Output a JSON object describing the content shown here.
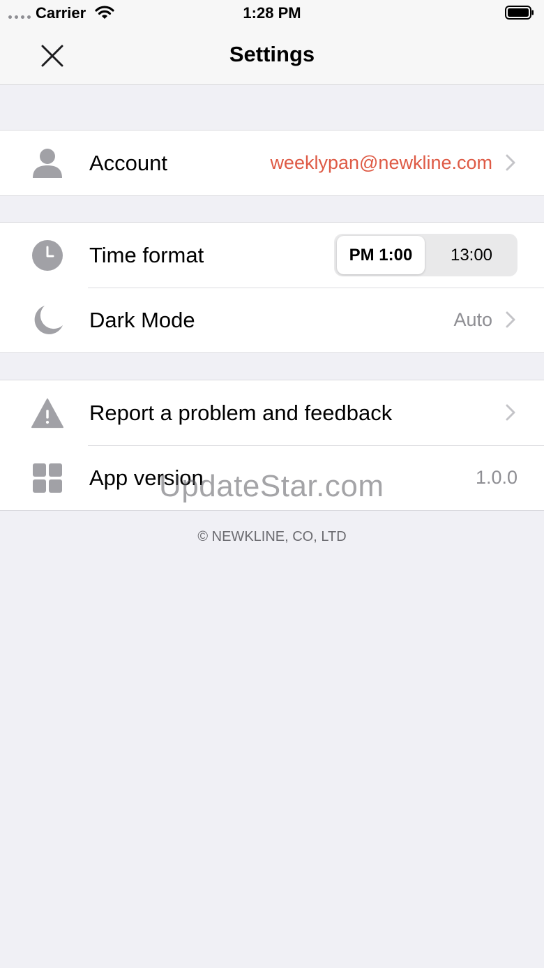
{
  "status_bar": {
    "carrier": "Carrier",
    "time": "1:28 PM"
  },
  "nav": {
    "title": "Settings"
  },
  "account": {
    "label": "Account",
    "value": "weeklypan@newkline.com"
  },
  "time_format": {
    "label": "Time format",
    "options": [
      "PM 1:00",
      "13:00"
    ],
    "selected": "PM 1:00"
  },
  "dark_mode": {
    "label": "Dark Mode",
    "value": "Auto"
  },
  "feedback": {
    "label": "Report a problem and feedback"
  },
  "app_version": {
    "label": "App version",
    "value": "1.0.0"
  },
  "footer": {
    "copyright": "© NEWKLINE, CO, LTD"
  },
  "watermark": "UpdateStar.com",
  "colors": {
    "accent": "#de5a45",
    "icon_gray": "#a1a1a6",
    "background": "#f0f0f5"
  },
  "icons": [
    "close-icon",
    "person-icon",
    "clock-icon",
    "moon-icon",
    "warning-icon",
    "grid-icon",
    "chevron-right-icon"
  ]
}
